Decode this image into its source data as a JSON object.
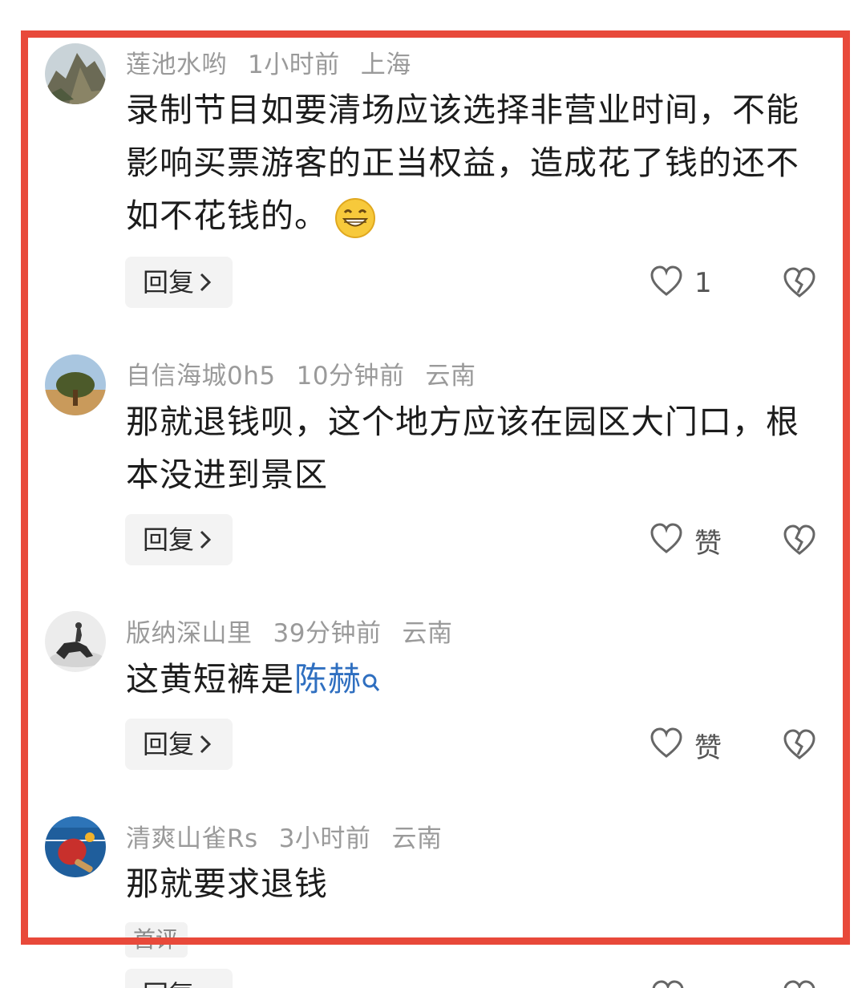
{
  "comments": [
    {
      "username": "莲池水哟",
      "time": "1小时前",
      "location": "上海",
      "text": "录制节目如要清场应该选择非营业时间，不能影响买票游客的正当权益，造成花了钱的还不如不花钱的。",
      "emoji": "grinning-face-emoji",
      "reply_label": "回复",
      "like_label": "1"
    },
    {
      "username": "自信海城0h5",
      "time": "10分钟前",
      "location": "云南",
      "text": "那就退钱呗，这个地方应该在园区大门口，根本没进到景区",
      "reply_label": "回复",
      "like_label": "赞"
    },
    {
      "username": "版纳深山里",
      "time": "39分钟前",
      "location": "云南",
      "text_prefix": "这黄短裤是",
      "text_link": "陈赫",
      "reply_label": "回复",
      "like_label": "赞"
    },
    {
      "username": "清爽山雀Rs",
      "time": "3小时前",
      "location": "云南",
      "text": "那就要求退钱",
      "partial_label": "首评",
      "reply_label": "回复"
    }
  ],
  "colors": {
    "highlight_border": "#e8493a",
    "link": "#2f6fc0",
    "meta": "#9a9a9a"
  },
  "icons": [
    "heart-icon",
    "broken-heart-icon",
    "chevron-right-icon",
    "search-icon"
  ]
}
